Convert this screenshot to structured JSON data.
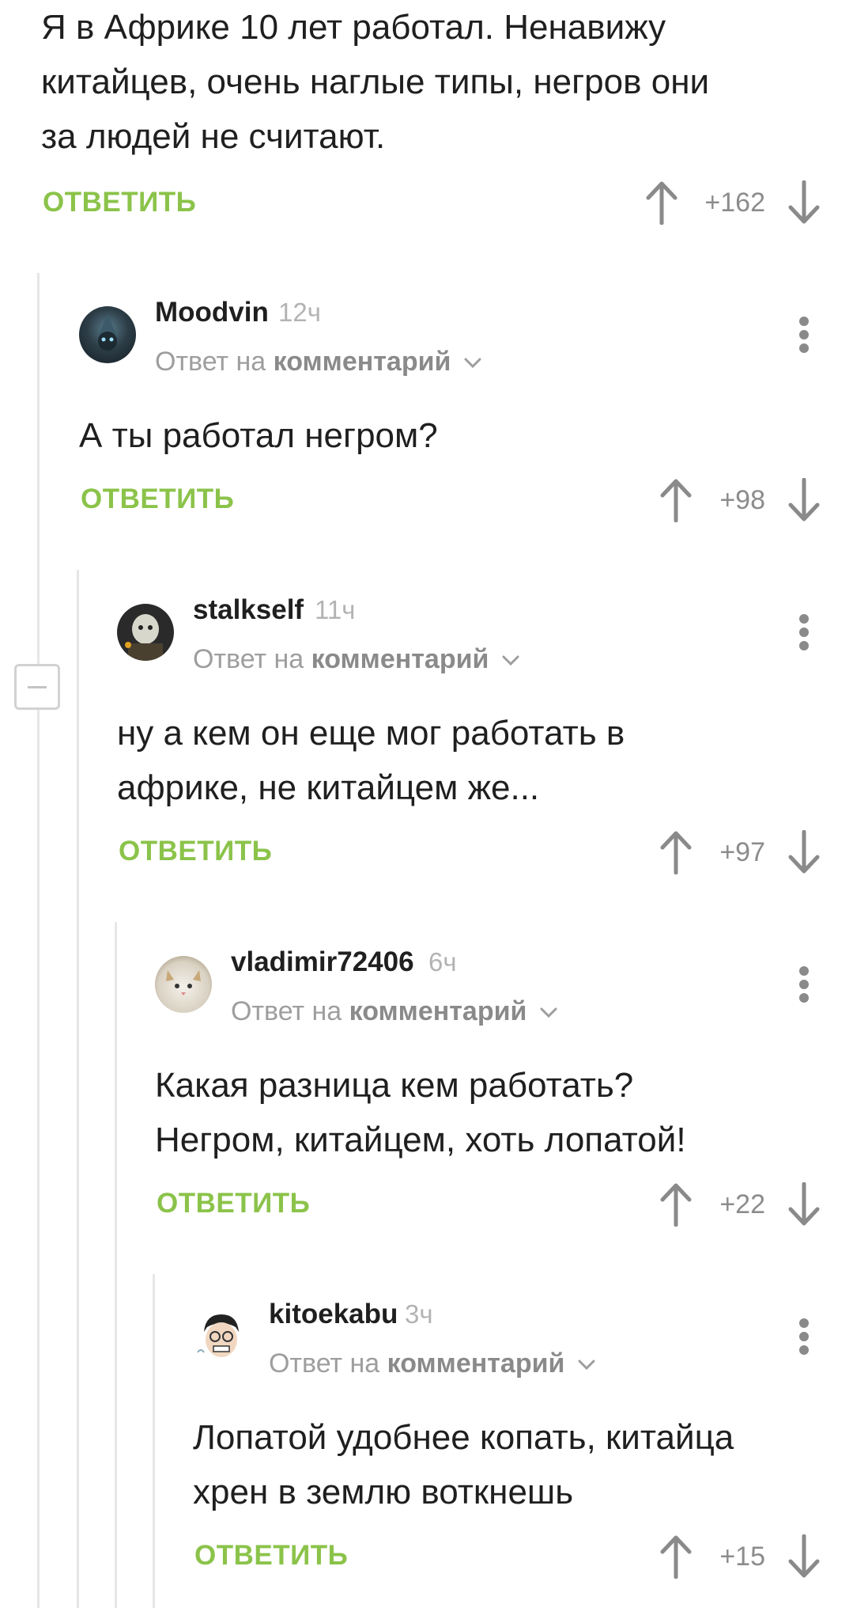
{
  "root_comment": {
    "text": "Я в Африке 10 лет работал. Ненавижу\nкитайцев, очень наглые типы, негров они\nза людей не считают.",
    "reply_label": "ОТВЕТИТЬ",
    "score": "+162"
  },
  "comments": [
    {
      "username": "Moodvin",
      "time": "12ч",
      "reply_to_prefix": "Ответ на",
      "reply_to_target": "комментарий",
      "text": "А ты работал негром?",
      "reply_label": "ОТВЕТИТЬ",
      "score": "+98"
    },
    {
      "username": "stalkself",
      "time": "11ч",
      "reply_to_prefix": "Ответ на",
      "reply_to_target": "комментарий",
      "text": "ну а кем он еще мог работать в\nафрике, не китайцем же...",
      "reply_label": "ОТВЕТИТЬ",
      "score": "+97"
    },
    {
      "username": "vladimir72406",
      "time": "6ч",
      "reply_to_prefix": "Ответ на",
      "reply_to_target": "комментарий",
      "text": "Какая разница кем работать?\nНегром, китайцем, хоть лопатой!",
      "reply_label": "ОТВЕТИТЬ",
      "score": "+22"
    },
    {
      "username": "kitoekabu",
      "time": "3ч",
      "reply_to_prefix": "Ответ на",
      "reply_to_target": "комментарий",
      "text": "Лопатой удобнее копать, китайца\nхрен в землю воткнешь",
      "reply_label": "ОТВЕТИТЬ",
      "score": "+15"
    }
  ],
  "icons": [
    "arrow-up-icon",
    "arrow-down-icon",
    "more-vertical-icon",
    "chevron-down-icon",
    "collapse-minus-icon"
  ],
  "colors": {
    "accent_green": "#8bc34a",
    "muted_gray": "#8c8c8c",
    "thread_line": "#e6e6e6"
  }
}
